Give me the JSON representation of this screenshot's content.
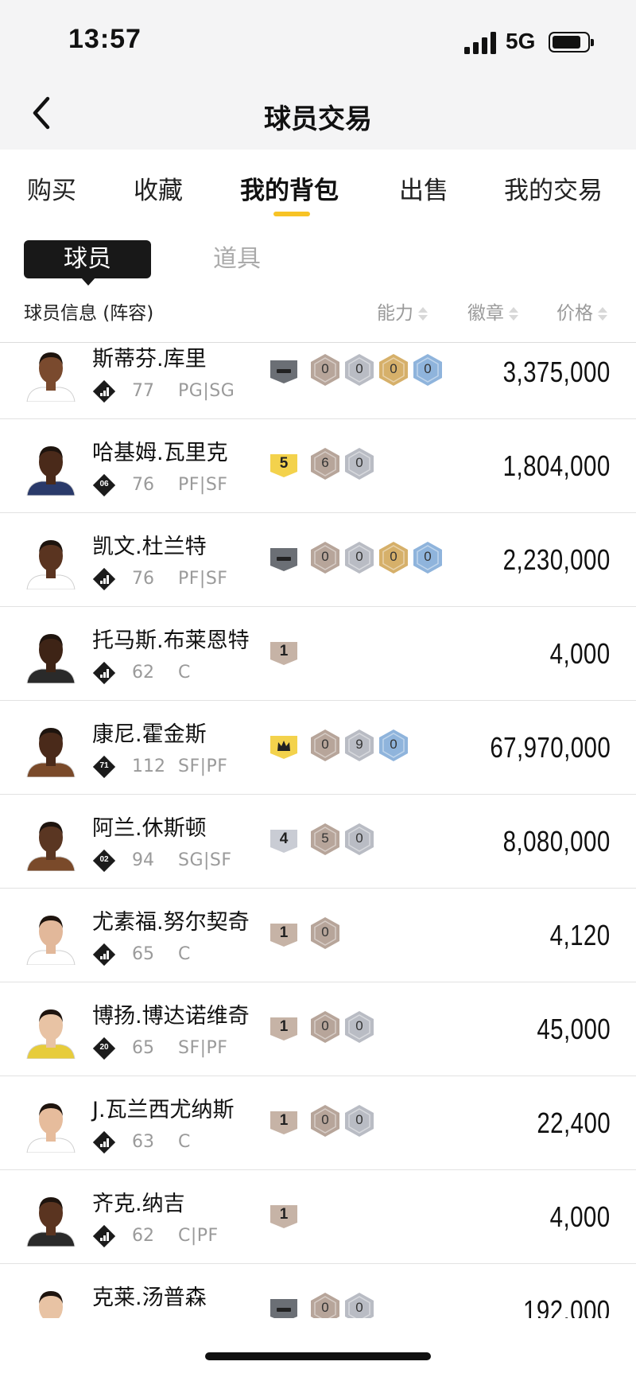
{
  "status_bar": {
    "time": "13:57",
    "network": "5G",
    "battery_level": 0.84
  },
  "header": {
    "title": "球员交易",
    "back_icon": "chevron-left-icon"
  },
  "tabs": [
    {
      "label": "购买",
      "active": false
    },
    {
      "label": "收藏",
      "active": false
    },
    {
      "label": "我的背包",
      "active": true
    },
    {
      "label": "出售",
      "active": false
    },
    {
      "label": "我的交易",
      "active": false
    }
  ],
  "subtabs": [
    {
      "label": "球员",
      "active": true
    },
    {
      "label": "道具",
      "active": false
    }
  ],
  "columns": {
    "info": "球员信息 (阵容)",
    "ability": "能力",
    "badges": "徽章",
    "price": "价格"
  },
  "colors": {
    "accent": "#f7c325",
    "badge_gray": "#6b6f75",
    "badge_bronze": "#b7a59a",
    "badge_silver": "#b9bcc4",
    "badge_gold": "#d6b06a",
    "badge_hof": "#8fb4dc",
    "tier_yellow": "#f3d24c",
    "tier_silver": "#c9ccd4",
    "tier_bronze": "#c6b3a6"
  },
  "players": [
    {
      "name": "斯蒂芬.库里",
      "level_icon": "bars",
      "level_num": "",
      "rating": "77",
      "position": "PG|SG",
      "tier": {
        "type": "gray",
        "label": ""
      },
      "badges": [
        {
          "color": "bronze",
          "count": "0"
        },
        {
          "color": "silver",
          "count": "0"
        },
        {
          "color": "gold",
          "count": "0"
        },
        {
          "color": "hof",
          "count": "0"
        }
      ],
      "price": "3,375,000"
    },
    {
      "name": "哈基姆.瓦里克",
      "level_icon": "num",
      "level_num": "06",
      "rating": "76",
      "position": "PF|SF",
      "tier": {
        "type": "yellow",
        "label": "5"
      },
      "badges": [
        {
          "color": "bronze",
          "count": "6"
        },
        {
          "color": "silver",
          "count": "0"
        }
      ],
      "price": "1,804,000"
    },
    {
      "name": "凯文.杜兰特",
      "level_icon": "bars",
      "level_num": "",
      "rating": "76",
      "position": "PF|SF",
      "tier": {
        "type": "gray",
        "label": ""
      },
      "badges": [
        {
          "color": "bronze",
          "count": "0"
        },
        {
          "color": "silver",
          "count": "0"
        },
        {
          "color": "gold",
          "count": "0"
        },
        {
          "color": "hof",
          "count": "0"
        }
      ],
      "price": "2,230,000"
    },
    {
      "name": "托马斯.布莱恩特",
      "level_icon": "bars",
      "level_num": "",
      "rating": "62",
      "position": "C",
      "tier": {
        "type": "bronze",
        "label": "1"
      },
      "badges": [],
      "price": "4,000"
    },
    {
      "name": "康尼.霍金斯",
      "level_icon": "num",
      "level_num": "71",
      "rating": "112",
      "position": "SF|PF",
      "tier": {
        "type": "crown",
        "label": ""
      },
      "badges": [
        {
          "color": "bronze",
          "count": "0"
        },
        {
          "color": "silver",
          "count": "9"
        },
        {
          "color": "hof",
          "count": "0"
        }
      ],
      "price": "67,970,000"
    },
    {
      "name": "阿兰.休斯顿",
      "level_icon": "num",
      "level_num": "02",
      "rating": "94",
      "position": "SG|SF",
      "tier": {
        "type": "silver",
        "label": "4"
      },
      "badges": [
        {
          "color": "bronze",
          "count": "5"
        },
        {
          "color": "silver",
          "count": "0"
        }
      ],
      "price": "8,080,000"
    },
    {
      "name": "尤素福.努尔契奇",
      "level_icon": "bars",
      "level_num": "",
      "rating": "65",
      "position": "C",
      "tier": {
        "type": "bronze",
        "label": "1"
      },
      "badges": [
        {
          "color": "bronze",
          "count": "0"
        }
      ],
      "price": "4,120"
    },
    {
      "name": "博扬.博达诺维奇",
      "level_icon": "num",
      "level_num": "20",
      "rating": "65",
      "position": "SF|PF",
      "tier": {
        "type": "bronze",
        "label": "1"
      },
      "badges": [
        {
          "color": "bronze",
          "count": "0"
        },
        {
          "color": "silver",
          "count": "0"
        }
      ],
      "price": "45,000"
    },
    {
      "name": "J.瓦兰西尤纳斯",
      "level_icon": "bars",
      "level_num": "",
      "rating": "63",
      "position": "C",
      "tier": {
        "type": "bronze",
        "label": "1"
      },
      "badges": [
        {
          "color": "bronze",
          "count": "0"
        },
        {
          "color": "silver",
          "count": "0"
        }
      ],
      "price": "22,400"
    },
    {
      "name": "齐克.纳吉",
      "level_icon": "bars",
      "level_num": "",
      "rating": "62",
      "position": "C|PF",
      "tier": {
        "type": "bronze",
        "label": "1"
      },
      "badges": [],
      "price": "4,000"
    },
    {
      "name": "克莱.汤普森",
      "level_icon": "bars",
      "level_num": "",
      "rating": "",
      "position": "",
      "tier": {
        "type": "gray",
        "label": ""
      },
      "badges": [
        {
          "color": "bronze",
          "count": "0"
        },
        {
          "color": "silver",
          "count": "0"
        }
      ],
      "price": "192,000"
    }
  ]
}
